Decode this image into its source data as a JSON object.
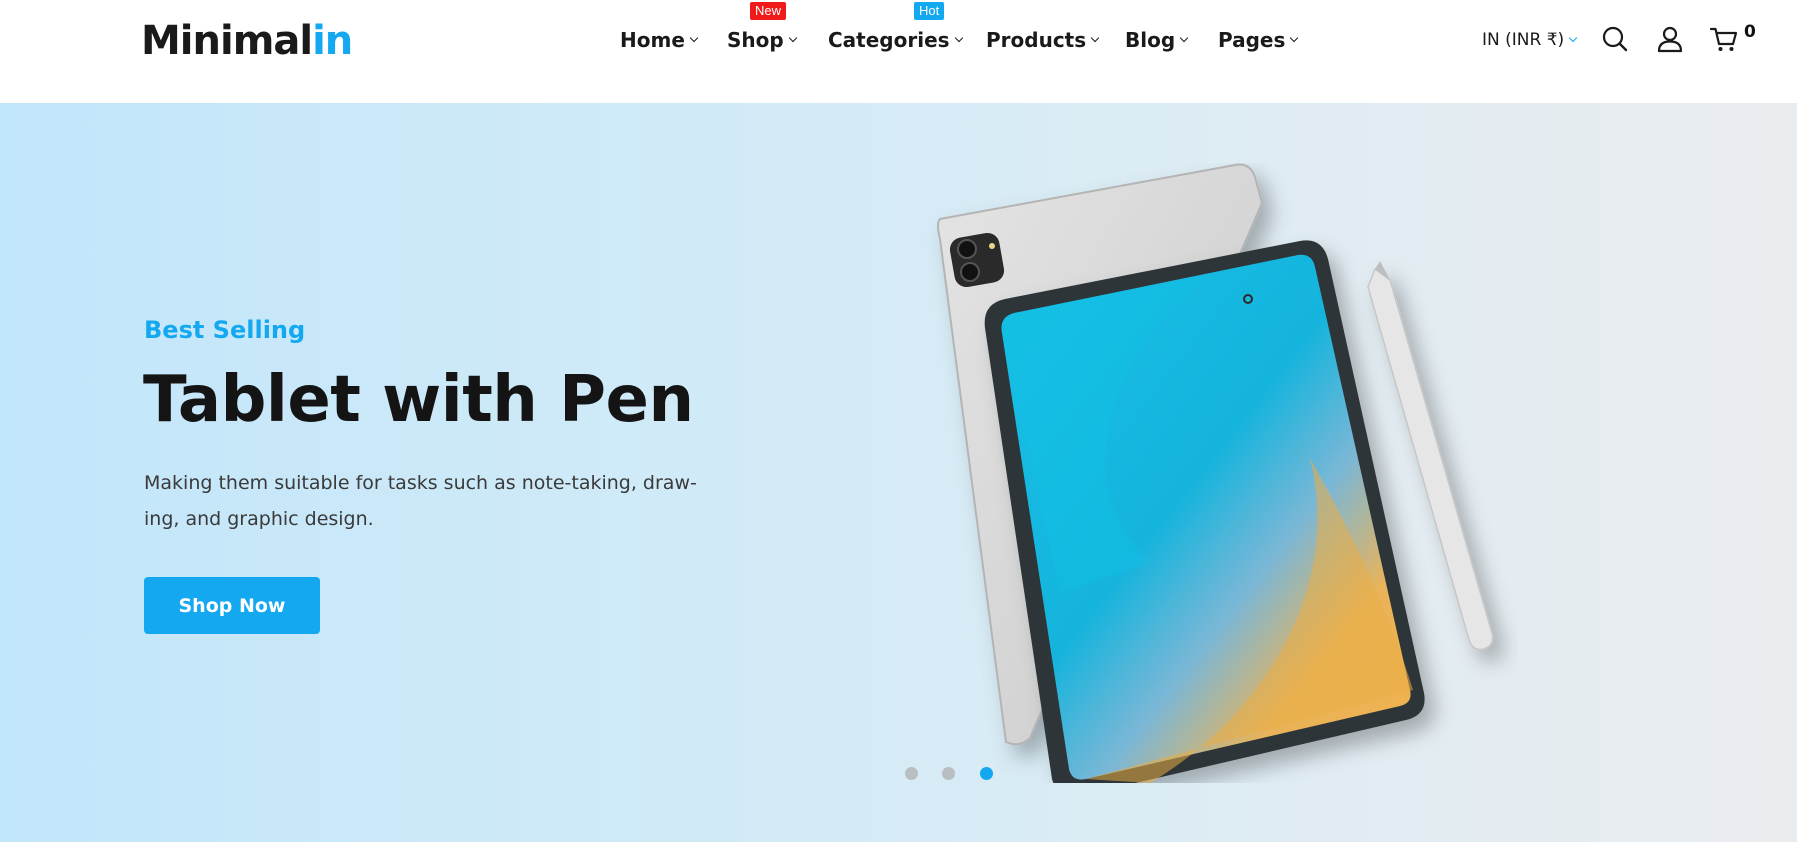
{
  "brand": {
    "part1": "Minimal",
    "part2": "in"
  },
  "nav": {
    "items": [
      {
        "label": "Home",
        "badge": ""
      },
      {
        "label": "Shop",
        "badge": "New"
      },
      {
        "label": "Categories",
        "badge": "Hot"
      },
      {
        "label": "Products",
        "badge": ""
      },
      {
        "label": "Blog",
        "badge": ""
      },
      {
        "label": "Pages",
        "badge": ""
      }
    ]
  },
  "header_tools": {
    "currency": "IN (INR ₹)",
    "cart_count": "0",
    "icons": [
      "search-icon",
      "user-icon",
      "cart-icon"
    ]
  },
  "hero": {
    "eyebrow": "Best Selling",
    "title": "Tablet with Pen",
    "description": "Making them suitable for tasks such as note-taking, draw- ing, and graphic design.",
    "cta": "Shop Now"
  },
  "slider": {
    "total_slides": 3,
    "active_slide": 3
  },
  "colors": {
    "accent": "#13a8f0",
    "badge_new": "#f01a1a",
    "badge_hot": "#13a8f0",
    "dot_inactive": "#b9bec3"
  }
}
